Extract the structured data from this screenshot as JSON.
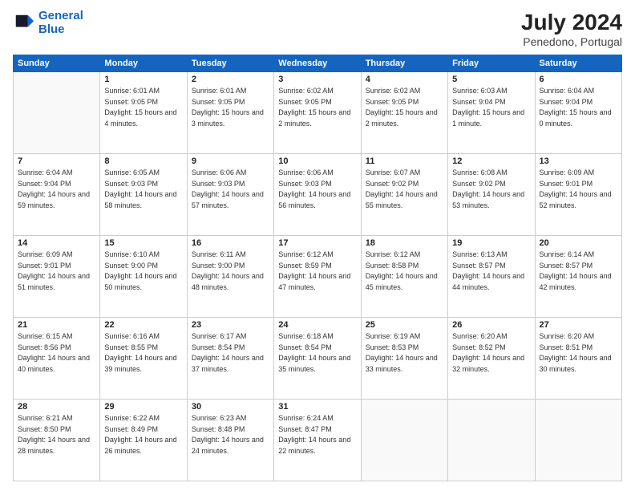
{
  "logo": {
    "line1": "General",
    "line2": "Blue"
  },
  "title": "July 2024",
  "location": "Penedono, Portugal",
  "days_of_week": [
    "Sunday",
    "Monday",
    "Tuesday",
    "Wednesday",
    "Thursday",
    "Friday",
    "Saturday"
  ],
  "weeks": [
    [
      {
        "num": "",
        "empty": true
      },
      {
        "num": "1",
        "sunrise": "Sunrise: 6:01 AM",
        "sunset": "Sunset: 9:05 PM",
        "daylight": "Daylight: 15 hours and 4 minutes."
      },
      {
        "num": "2",
        "sunrise": "Sunrise: 6:01 AM",
        "sunset": "Sunset: 9:05 PM",
        "daylight": "Daylight: 15 hours and 3 minutes."
      },
      {
        "num": "3",
        "sunrise": "Sunrise: 6:02 AM",
        "sunset": "Sunset: 9:05 PM",
        "daylight": "Daylight: 15 hours and 2 minutes."
      },
      {
        "num": "4",
        "sunrise": "Sunrise: 6:02 AM",
        "sunset": "Sunset: 9:05 PM",
        "daylight": "Daylight: 15 hours and 2 minutes."
      },
      {
        "num": "5",
        "sunrise": "Sunrise: 6:03 AM",
        "sunset": "Sunset: 9:04 PM",
        "daylight": "Daylight: 15 hours and 1 minute."
      },
      {
        "num": "6",
        "sunrise": "Sunrise: 6:04 AM",
        "sunset": "Sunset: 9:04 PM",
        "daylight": "Daylight: 15 hours and 0 minutes."
      }
    ],
    [
      {
        "num": "7",
        "sunrise": "Sunrise: 6:04 AM",
        "sunset": "Sunset: 9:04 PM",
        "daylight": "Daylight: 14 hours and 59 minutes."
      },
      {
        "num": "8",
        "sunrise": "Sunrise: 6:05 AM",
        "sunset": "Sunset: 9:03 PM",
        "daylight": "Daylight: 14 hours and 58 minutes."
      },
      {
        "num": "9",
        "sunrise": "Sunrise: 6:06 AM",
        "sunset": "Sunset: 9:03 PM",
        "daylight": "Daylight: 14 hours and 57 minutes."
      },
      {
        "num": "10",
        "sunrise": "Sunrise: 6:06 AM",
        "sunset": "Sunset: 9:03 PM",
        "daylight": "Daylight: 14 hours and 56 minutes."
      },
      {
        "num": "11",
        "sunrise": "Sunrise: 6:07 AM",
        "sunset": "Sunset: 9:02 PM",
        "daylight": "Daylight: 14 hours and 55 minutes."
      },
      {
        "num": "12",
        "sunrise": "Sunrise: 6:08 AM",
        "sunset": "Sunset: 9:02 PM",
        "daylight": "Daylight: 14 hours and 53 minutes."
      },
      {
        "num": "13",
        "sunrise": "Sunrise: 6:09 AM",
        "sunset": "Sunset: 9:01 PM",
        "daylight": "Daylight: 14 hours and 52 minutes."
      }
    ],
    [
      {
        "num": "14",
        "sunrise": "Sunrise: 6:09 AM",
        "sunset": "Sunset: 9:01 PM",
        "daylight": "Daylight: 14 hours and 51 minutes."
      },
      {
        "num": "15",
        "sunrise": "Sunrise: 6:10 AM",
        "sunset": "Sunset: 9:00 PM",
        "daylight": "Daylight: 14 hours and 50 minutes."
      },
      {
        "num": "16",
        "sunrise": "Sunrise: 6:11 AM",
        "sunset": "Sunset: 9:00 PM",
        "daylight": "Daylight: 14 hours and 48 minutes."
      },
      {
        "num": "17",
        "sunrise": "Sunrise: 6:12 AM",
        "sunset": "Sunset: 8:59 PM",
        "daylight": "Daylight: 14 hours and 47 minutes."
      },
      {
        "num": "18",
        "sunrise": "Sunrise: 6:12 AM",
        "sunset": "Sunset: 8:58 PM",
        "daylight": "Daylight: 14 hours and 45 minutes."
      },
      {
        "num": "19",
        "sunrise": "Sunrise: 6:13 AM",
        "sunset": "Sunset: 8:57 PM",
        "daylight": "Daylight: 14 hours and 44 minutes."
      },
      {
        "num": "20",
        "sunrise": "Sunrise: 6:14 AM",
        "sunset": "Sunset: 8:57 PM",
        "daylight": "Daylight: 14 hours and 42 minutes."
      }
    ],
    [
      {
        "num": "21",
        "sunrise": "Sunrise: 6:15 AM",
        "sunset": "Sunset: 8:56 PM",
        "daylight": "Daylight: 14 hours and 40 minutes."
      },
      {
        "num": "22",
        "sunrise": "Sunrise: 6:16 AM",
        "sunset": "Sunset: 8:55 PM",
        "daylight": "Daylight: 14 hours and 39 minutes."
      },
      {
        "num": "23",
        "sunrise": "Sunrise: 6:17 AM",
        "sunset": "Sunset: 8:54 PM",
        "daylight": "Daylight: 14 hours and 37 minutes."
      },
      {
        "num": "24",
        "sunrise": "Sunrise: 6:18 AM",
        "sunset": "Sunset: 8:54 PM",
        "daylight": "Daylight: 14 hours and 35 minutes."
      },
      {
        "num": "25",
        "sunrise": "Sunrise: 6:19 AM",
        "sunset": "Sunset: 8:53 PM",
        "daylight": "Daylight: 14 hours and 33 minutes."
      },
      {
        "num": "26",
        "sunrise": "Sunrise: 6:20 AM",
        "sunset": "Sunset: 8:52 PM",
        "daylight": "Daylight: 14 hours and 32 minutes."
      },
      {
        "num": "27",
        "sunrise": "Sunrise: 6:20 AM",
        "sunset": "Sunset: 8:51 PM",
        "daylight": "Daylight: 14 hours and 30 minutes."
      }
    ],
    [
      {
        "num": "28",
        "sunrise": "Sunrise: 6:21 AM",
        "sunset": "Sunset: 8:50 PM",
        "daylight": "Daylight: 14 hours and 28 minutes."
      },
      {
        "num": "29",
        "sunrise": "Sunrise: 6:22 AM",
        "sunset": "Sunset: 8:49 PM",
        "daylight": "Daylight: 14 hours and 26 minutes."
      },
      {
        "num": "30",
        "sunrise": "Sunrise: 6:23 AM",
        "sunset": "Sunset: 8:48 PM",
        "daylight": "Daylight: 14 hours and 24 minutes."
      },
      {
        "num": "31",
        "sunrise": "Sunrise: 6:24 AM",
        "sunset": "Sunset: 8:47 PM",
        "daylight": "Daylight: 14 hours and 22 minutes."
      },
      {
        "num": "",
        "empty": true
      },
      {
        "num": "",
        "empty": true
      },
      {
        "num": "",
        "empty": true
      }
    ]
  ]
}
